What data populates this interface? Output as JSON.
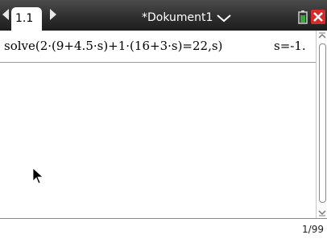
{
  "header": {
    "page_tab": "1.1",
    "document_title": "*Dokument1"
  },
  "calculator": {
    "entries": [
      {
        "expression": "solve(2·(9+4.5·s)+1·(16+3·s)=22,s)",
        "result": "s=-1."
      }
    ]
  },
  "status": {
    "page_count": "1/99"
  },
  "colors": {
    "titlebar": "#2f2f2f",
    "close": "#d62b2b",
    "battery": "#3aa53a"
  }
}
